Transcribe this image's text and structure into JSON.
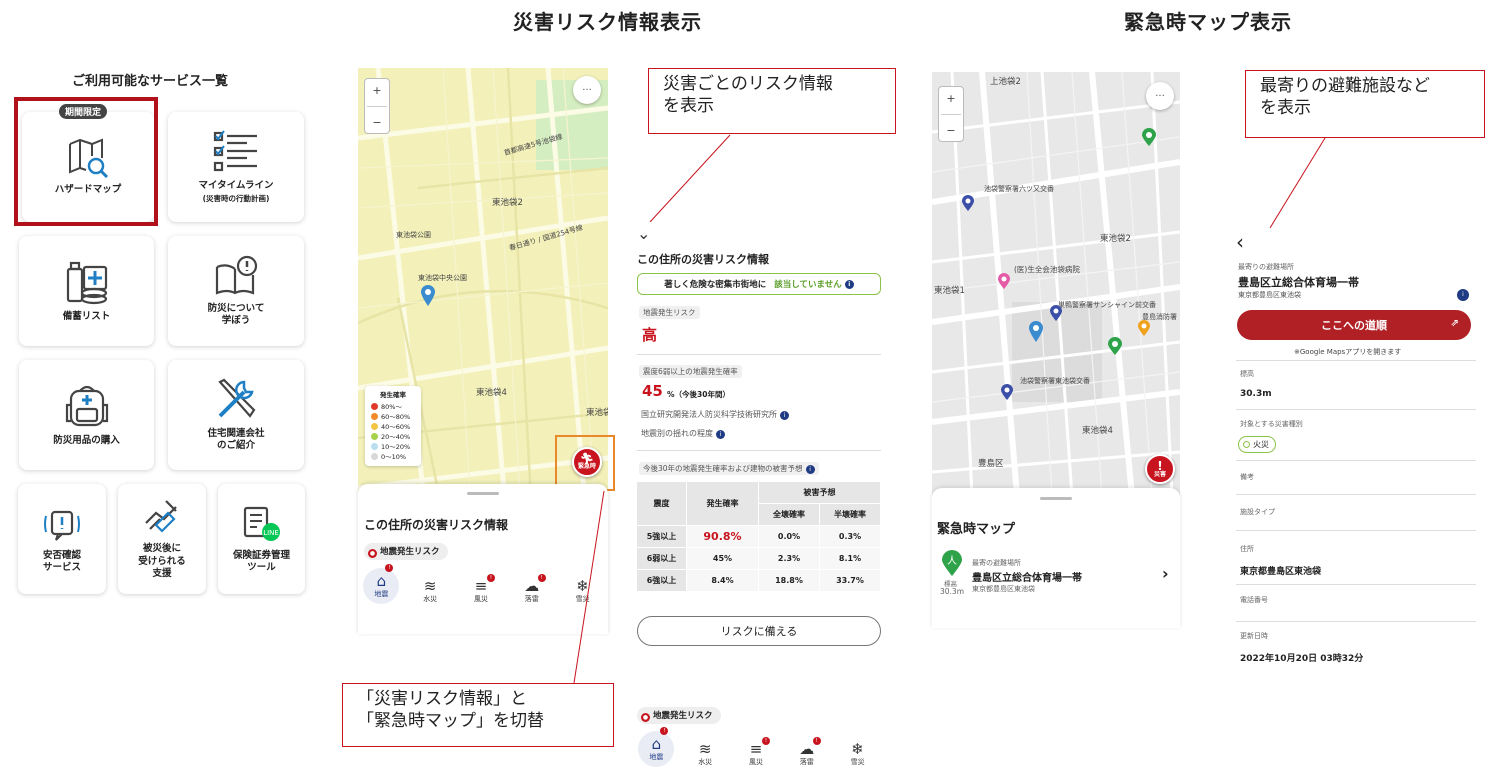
{
  "headings": {
    "risk": "災害リスク情報表示",
    "emergency": "緊急時マップ表示"
  },
  "services": {
    "title": "ご利用可能なサービス一覧",
    "badge": "期間限定",
    "items": [
      {
        "label": "ハザードマップ",
        "sub": "",
        "icon": "hazard-map-icon"
      },
      {
        "label": "マイタイムライン",
        "sub": "(災害時の行動計画)",
        "icon": "checklist-icon"
      },
      {
        "label": "備蓄リスト",
        "sub": "",
        "icon": "stockpile-icon"
      },
      {
        "label": "防災について\n学ぼう",
        "sub": "",
        "icon": "book-icon"
      },
      {
        "label": "防災用品の購入",
        "sub": "",
        "icon": "backpack-icon"
      },
      {
        "label": "住宅関連会社\nのご紹介",
        "sub": "",
        "icon": "tools-icon"
      },
      {
        "label": "安否確認\nサービス",
        "sub": "",
        "icon": "safety-check-icon"
      },
      {
        "label": "被災後に\n受けられる\n支援",
        "sub": "",
        "icon": "support-icon"
      },
      {
        "label": "保険証券管理\nツール",
        "sub": "",
        "icon": "insurance-icon"
      }
    ]
  },
  "map1": {
    "zoom_in": "+",
    "zoom_out": "−",
    "more": "···",
    "labels": [
      "東池袋2",
      "東池袋公園",
      "東池袋中央公園",
      "東池袋4",
      "東池袋5",
      "春日通り / 国道254号線",
      "首都高速5号池袋線"
    ],
    "legend": {
      "title": "発生確率",
      "items": [
        {
          "label": "80%〜",
          "color": "#e23a2a"
        },
        {
          "label": "60〜80%",
          "color": "#f28a2a"
        },
        {
          "label": "40〜60%",
          "color": "#f5c542"
        },
        {
          "label": "20〜40%",
          "color": "#a6d14b"
        },
        {
          "label": "10〜20%",
          "color": "#b9def0"
        },
        {
          "label": "0〜10%",
          "color": "#d8d8d8"
        }
      ]
    },
    "emergency_button": "緊急時",
    "sheet_title": "この住所の災害リスク情報",
    "chip": "地震発生リスク"
  },
  "tabs": [
    {
      "label": "地震",
      "glyph": "⌂"
    },
    {
      "label": "水災",
      "glyph": "≋"
    },
    {
      "label": "風災",
      "glyph": "≡"
    },
    {
      "label": "落雷",
      "glyph": "☁"
    },
    {
      "label": "雪災",
      "glyph": "❄"
    }
  ],
  "risk_panel": {
    "title": "この住所の災害リスク情報",
    "dense_area_label": "著しく危険な密集市街地に",
    "dense_area_value": "該当していません",
    "quake_risk_tag": "地震発生リスク",
    "quake_risk_value": "高",
    "prob_tag": "震度6弱以上の地震発生確率",
    "prob_value": "45",
    "prob_unit": "%（今後30年間）",
    "source": "国立研究開発法人防災科学技術研究所",
    "shake_link": "地震別の揺れの程度",
    "forecast_tag": "今後30年の地震発生確率および建物の被害予想",
    "table": {
      "h_intensity": "震度",
      "h_prob": "発生確率",
      "h_damage": "被害予想",
      "h_full": "全壊確率",
      "h_half": "半壊確率",
      "rows": [
        {
          "i": "5強以上",
          "p": "90.8%",
          "f": "0.0%",
          "h": "0.3%"
        },
        {
          "i": "6弱以上",
          "p": "45%",
          "f": "2.3%",
          "h": "8.1%"
        },
        {
          "i": "6強以上",
          "p": "8.4%",
          "f": "18.8%",
          "h": "33.7%"
        }
      ]
    },
    "prepare_button": "リスクに備える",
    "chip": "地震発生リスク"
  },
  "callouts": {
    "risk_info": "災害ごとのリスク情報\nを表示",
    "switch": "「災害リスク情報」と\n「緊急時マップ」を切替",
    "shelter": "最寄りの避難施設など\nを表示"
  },
  "map2": {
    "zoom_in": "+",
    "zoom_out": "−",
    "more": "···",
    "labels": [
      "上池袋2",
      "池袋警察署六ツ又交番",
      "東池袋2",
      "(医)生全会池袋病院",
      "東池袋1",
      "巣鴨警察署サンシャイン前交番",
      "豊島消防署",
      "池袋警察署東池袋交番",
      "東池袋4",
      "豊島区"
    ],
    "disaster_button": "災害",
    "sheet_title": "緊急時マップ",
    "nearest_label": "最寄の避難場所",
    "place_name": "豊島区立総合体育場一帯",
    "place_address": "東京都豊島区東池袋",
    "elev_label": "標高",
    "elev_value": "30.3m"
  },
  "shelter_panel": {
    "back": "‹",
    "nearest_label": "最寄りの避難場所",
    "name": "豊島区立総合体育場一帯",
    "address": "東京都豊島区東池袋",
    "route_button": "ここへの道順",
    "route_note": "※Google Mapsアプリを開きます",
    "elev_label": "標高",
    "elev_value": "30.3m",
    "disaster_type_label": "対象とする災害種別",
    "disaster_type_value": "火災",
    "remarks_label": "備考",
    "facility_label": "施設タイプ",
    "address_label": "住所",
    "address_value": "東京都豊島区東池袋",
    "phone_label": "電話番号",
    "updated_label": "更新日時",
    "updated_value": "2022年10月20日 03時32分"
  },
  "colors": {
    "accent_red": "#b1111b",
    "brand_navy": "#1f3b84",
    "map_yellow": "#f3f1b9",
    "map_gray": "#e6e6e6"
  }
}
